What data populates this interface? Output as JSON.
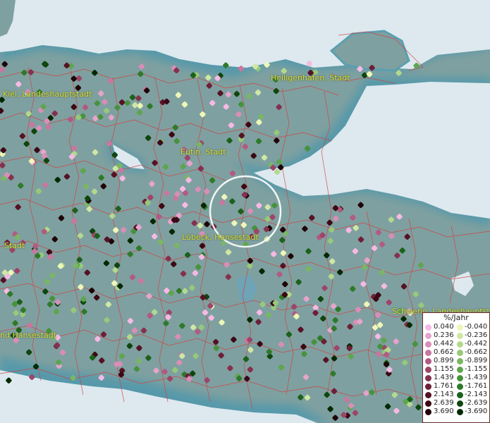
{
  "map": {
    "cities": [
      {
        "key": "heiligenhafen",
        "label": "Heiligenhafen, Stadt"
      },
      {
        "key": "kiel",
        "label": "Kiel, Landeshauptstadt"
      },
      {
        "key": "eutin",
        "label": "Eutin, Stadt"
      },
      {
        "key": "luebeck",
        "label": "Lübeck, Hansestadt"
      },
      {
        "key": "stadt_left",
        "label": "Stadt"
      },
      {
        "key": "hansestadt_left",
        "label": "nd Hansestadt"
      },
      {
        "key": "schwerin",
        "label": "Schwerin, Landeshauptstadt"
      }
    ],
    "colors": {
      "water": "#dde9ef",
      "land": "#7fa0a0",
      "coast_glow": "#5a9fb0",
      "boundary": "#d04040",
      "city_label": "#e0df2a"
    }
  },
  "legend": {
    "title": "%/Jahr",
    "positive": [
      {
        "value": "0.040",
        "color": "#f6b9e4"
      },
      {
        "value": "0.236",
        "color": "#e5a4cb"
      },
      {
        "value": "0.442",
        "color": "#d98eb7"
      },
      {
        "value": "0.662",
        "color": "#c8779f"
      },
      {
        "value": "0.899",
        "color": "#b25a84"
      },
      {
        "value": "1.155",
        "color": "#9d4569"
      },
      {
        "value": "1.439",
        "color": "#86304f"
      },
      {
        "value": "1.761",
        "color": "#6e1f38"
      },
      {
        "value": "2.143",
        "color": "#561224"
      },
      {
        "value": "2.639",
        "color": "#3b0814"
      },
      {
        "value": "3.690",
        "color": "#1f0207"
      }
    ],
    "negative": [
      {
        "value": "-0.040",
        "color": "#eef7b8"
      },
      {
        "value": "-0.236",
        "color": "#cfe7a4"
      },
      {
        "value": "-0.442",
        "color": "#b3d98e"
      },
      {
        "value": "-0.662",
        "color": "#96c97a"
      },
      {
        "value": "-0.899",
        "color": "#79b764"
      },
      {
        "value": "-1.155",
        "color": "#5ea54f"
      },
      {
        "value": "-1.439",
        "color": "#47923d"
      },
      {
        "value": "-1.761",
        "color": "#2f7a2a"
      },
      {
        "value": "-2.143",
        "color": "#1c611b"
      },
      {
        "value": "-2.639",
        "color": "#0e460e"
      },
      {
        "value": "-3.690",
        "color": "#032903"
      }
    ]
  }
}
